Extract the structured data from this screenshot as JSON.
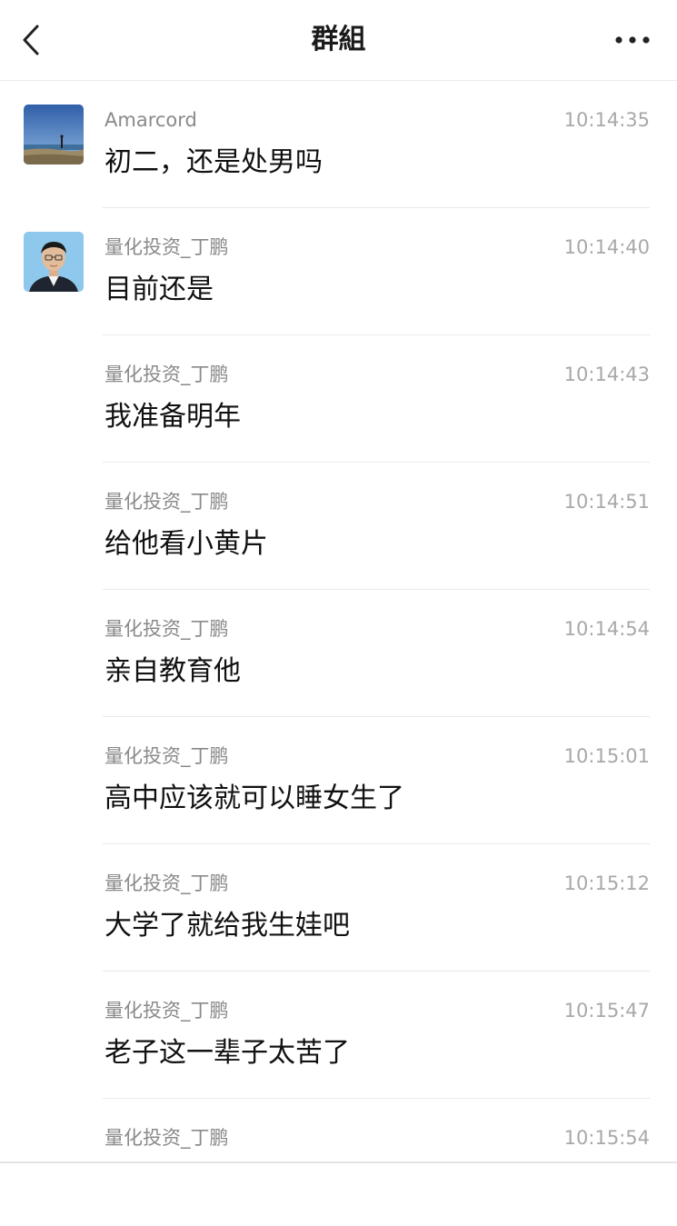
{
  "header": {
    "title": "群組",
    "back_icon": "chevron-left-icon",
    "more_icon": "more-horizontal-icon"
  },
  "messages": [
    {
      "sender": "Amarcord",
      "time": "10:14:35",
      "text": "初二，还是处男吗",
      "avatar": "landscape-avatar"
    },
    {
      "sender": "量化投资_丁鹏",
      "time": "10:14:40",
      "text": "目前还是",
      "avatar": "portrait-avatar"
    },
    {
      "sender": "量化投资_丁鹏",
      "time": "10:14:43",
      "text": "我准备明年"
    },
    {
      "sender": "量化投资_丁鹏",
      "time": "10:14:51",
      "text": "给他看小黄片"
    },
    {
      "sender": "量化投资_丁鹏",
      "time": "10:14:54",
      "text": "亲自教育他"
    },
    {
      "sender": "量化投资_丁鹏",
      "time": "10:15:01",
      "text": "高中应该就可以睡女生了"
    },
    {
      "sender": "量化投资_丁鹏",
      "time": "10:15:12",
      "text": "大学了就给我生娃吧"
    },
    {
      "sender": "量化投资_丁鹏",
      "time": "10:15:47",
      "text": "老子这一辈子太苦了"
    },
    {
      "sender": "量化投资_丁鹏",
      "time": "10:15:54",
      "text": ""
    }
  ],
  "colors": {
    "sender": "#8a8a8a",
    "time": "#a8a8a8",
    "text": "#111111",
    "divider": "#e9e9e9"
  }
}
